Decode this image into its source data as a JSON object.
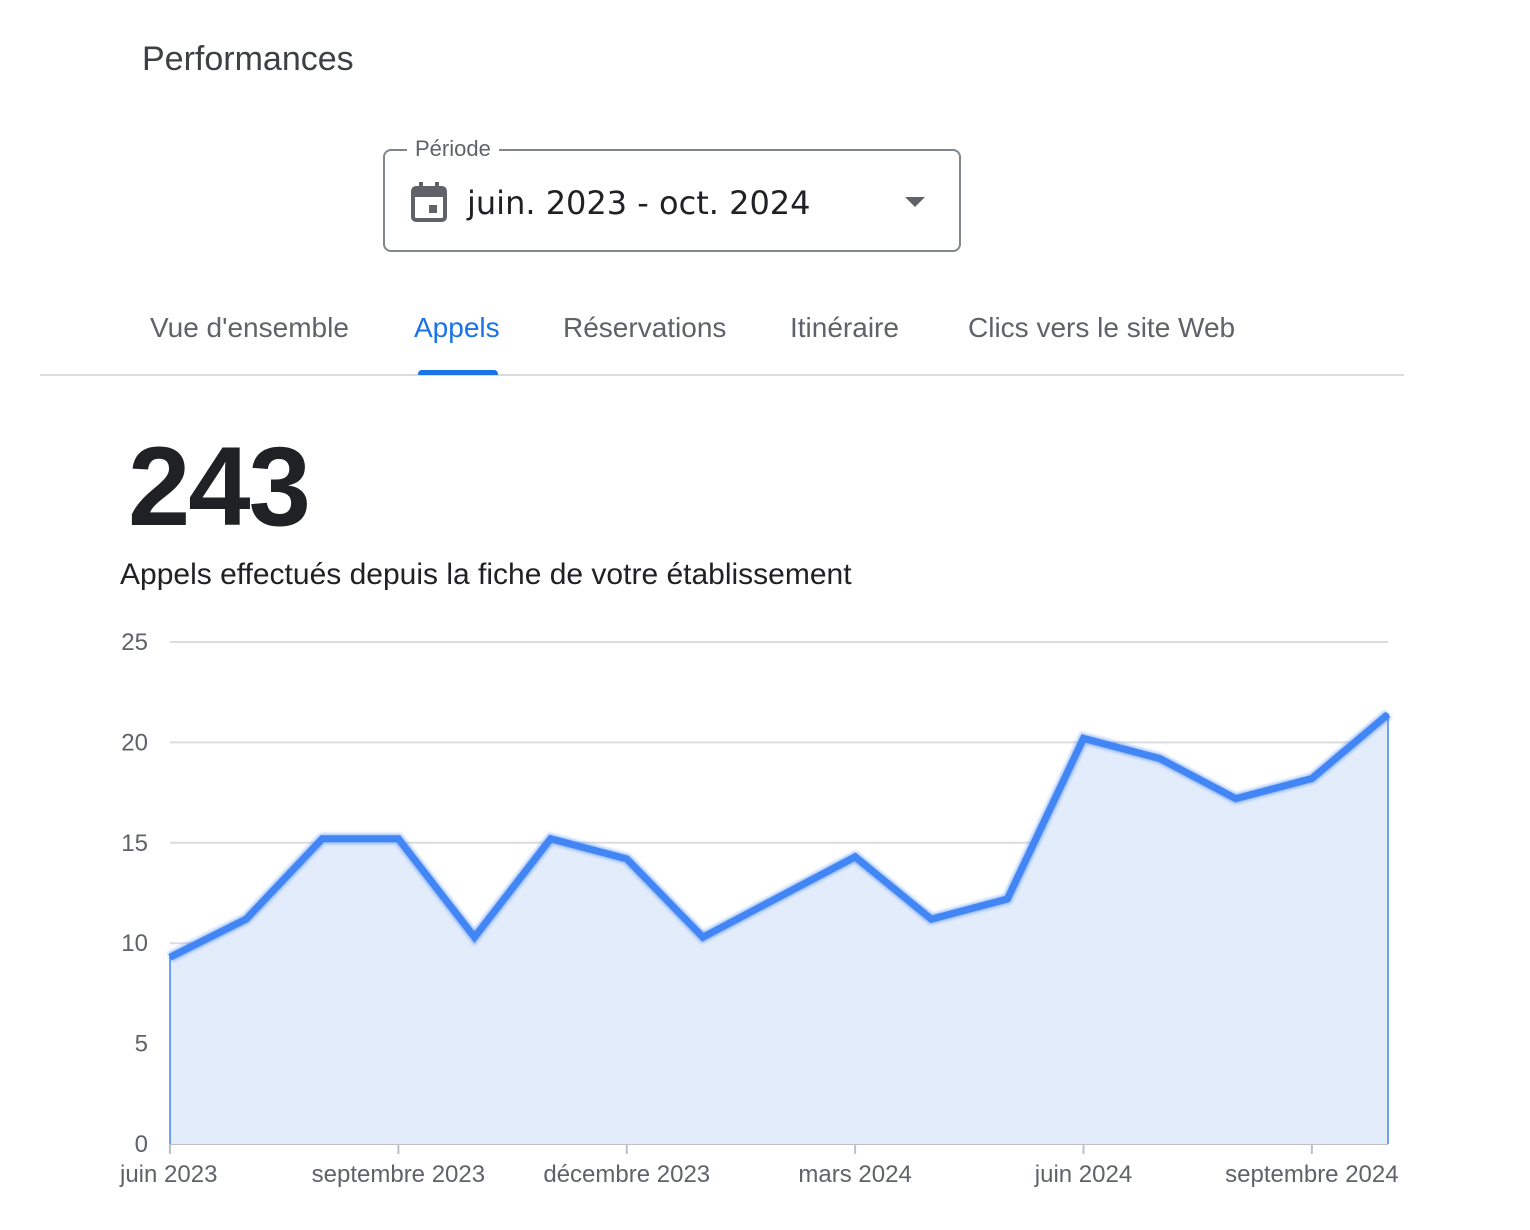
{
  "header": {
    "title": "Performances"
  },
  "period": {
    "label": "Période",
    "value": "juin. 2023 - oct. 2024",
    "icon": "calendar-icon"
  },
  "tabs": [
    {
      "label": "Vue d'ensemble",
      "active": false
    },
    {
      "label": "Appels",
      "active": true
    },
    {
      "label": "Réservations",
      "active": false
    },
    {
      "label": "Itinéraire",
      "active": false
    },
    {
      "label": "Clics vers le site Web",
      "active": false
    }
  ],
  "metric": {
    "value": "243",
    "caption": "Appels effectués depuis la fiche de votre établissement"
  },
  "colors": {
    "accent": "#1a73e8",
    "line": "#4285f4",
    "area": "#e3ecfb",
    "grid": "#dadce0"
  },
  "chart_data": {
    "type": "area",
    "x": [
      "2023-06",
      "2023-07",
      "2023-08",
      "2023-09",
      "2023-10",
      "2023-11",
      "2023-12",
      "2024-01",
      "2024-02",
      "2024-03",
      "2024-04",
      "2024-05",
      "2024-06",
      "2024-07",
      "2024-08",
      "2024-09",
      "2024-10"
    ],
    "series": [
      {
        "values": [
          9.3,
          11.2,
          15.2,
          15.2,
          10.3,
          15.2,
          14.2,
          10.3,
          12.3,
          14.3,
          11.2,
          12.2,
          20.2,
          19.2,
          17.2,
          18.2,
          21.4
        ]
      }
    ],
    "ylim": [
      0,
      25
    ],
    "yticks": [
      "0",
      "5",
      "10",
      "15",
      "20",
      "25"
    ],
    "xticks": [
      {
        "label": "juin 2023",
        "month_index": 0
      },
      {
        "label": "septembre 2023",
        "month_index": 3
      },
      {
        "label": "décembre 2023",
        "month_index": 6
      },
      {
        "label": "mars 2024",
        "month_index": 9
      },
      {
        "label": "juin 2024",
        "month_index": 12
      },
      {
        "label": "septembre 2024",
        "month_index": 15
      }
    ],
    "grid": true,
    "xlabel": "",
    "ylabel": "",
    "title": ""
  }
}
